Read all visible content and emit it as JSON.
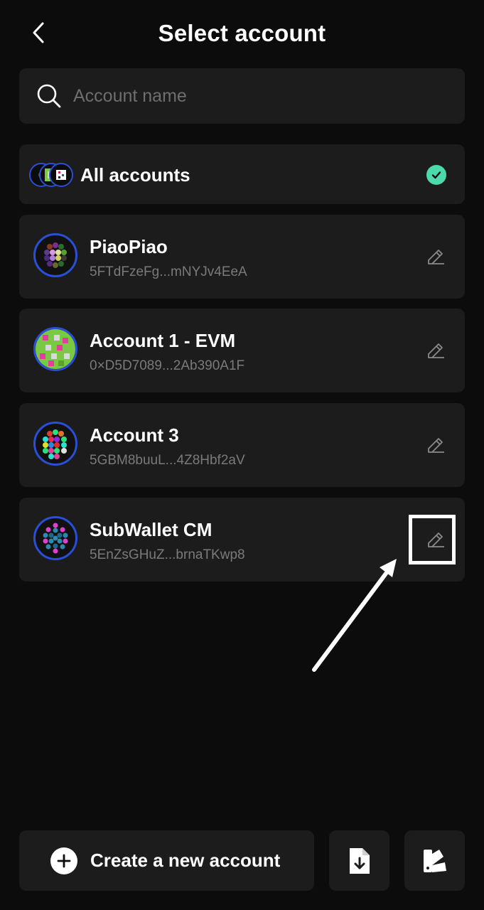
{
  "header": {
    "title": "Select account"
  },
  "search": {
    "placeholder": "Account name",
    "value": ""
  },
  "all_accounts": {
    "label": "All accounts",
    "selected": true
  },
  "accounts": [
    {
      "name": "PiaoPiao",
      "address": "5FTdFzeFg...mNYJv4EeA"
    },
    {
      "name": "Account 1 - EVM",
      "address": "0×D5D7089...2Ab390A1F"
    },
    {
      "name": "Account 3",
      "address": "5GBM8buuL...4Z8Hbf2aV"
    },
    {
      "name": "SubWallet CM",
      "address": "5EnZsGHuZ...brnaTKwp8"
    }
  ],
  "footer": {
    "create_label": "Create a new account",
    "import_icon": "file-download-icon",
    "attach_icon": "swatch-icon"
  },
  "colors": {
    "background": "#0c0c0c",
    "card": "#1c1c1c",
    "accent_check": "#4cd9ac",
    "avatar_ring": "#2a4fd6"
  }
}
